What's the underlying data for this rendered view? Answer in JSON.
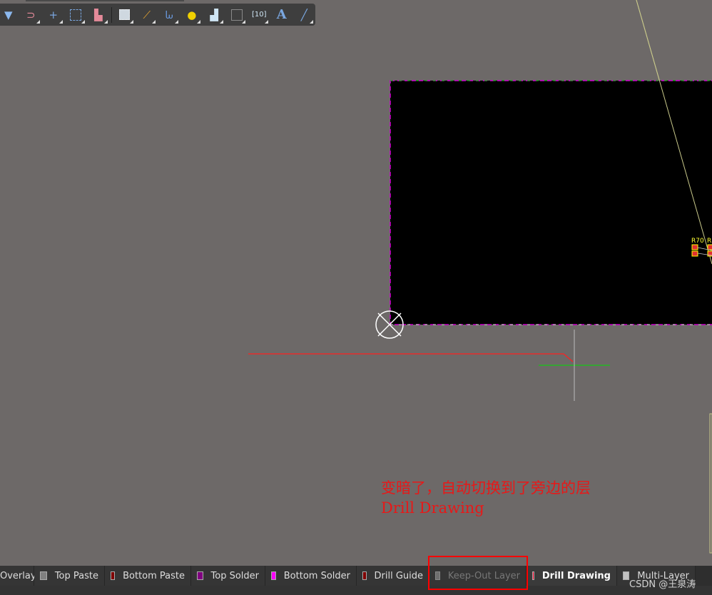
{
  "toolbar": {
    "tools": [
      "filter-icon",
      "snap-magnet-icon",
      "crosshair-origin-icon",
      "select-rect-icon",
      "align-icon",
      "component-icon",
      "route-icon",
      "length-tune-icon",
      "via-pad-icon",
      "polygon-icon",
      "keepout-icon",
      "dimension-icon",
      "text-icon",
      "line-icon"
    ],
    "text_glyph": "A"
  },
  "canvas": {
    "board_color": "#000000",
    "designators": [
      "R70",
      "R"
    ],
    "annotation_line1": "变暗了，自动切换到了旁边的层",
    "annotation_line2": "Drill Drawing"
  },
  "layers": [
    {
      "label": "Overlay",
      "color": null
    },
    {
      "label": "Top Paste",
      "color": "#808080"
    },
    {
      "label": "Bottom Paste",
      "color": "#800000"
    },
    {
      "label": "Top Solder",
      "color": "#800080"
    },
    {
      "label": "Bottom Solder",
      "color": "#ff00ff"
    },
    {
      "label": "Drill Guide",
      "color": "#800000"
    },
    {
      "label": "Keep-Out Layer",
      "color": "#6e6e6e",
      "state": "dimmed"
    },
    {
      "label": "Drill Drawing",
      "color": "#ff002a",
      "state": "active"
    },
    {
      "label": "Multi-Layer",
      "color": "#c0c0c0"
    }
  ],
  "watermark": "CSDN @王泉涛"
}
